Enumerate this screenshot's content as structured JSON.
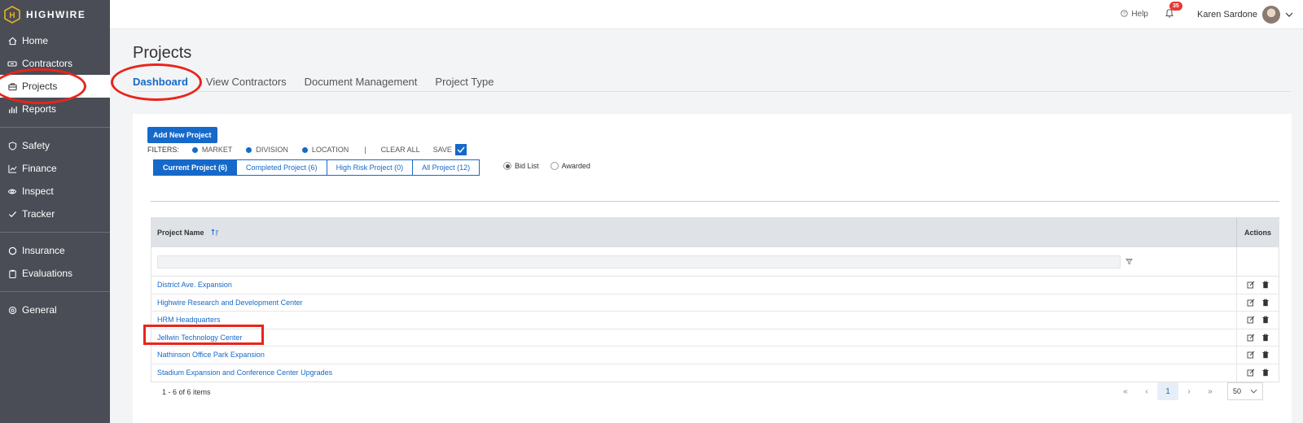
{
  "brand": {
    "name": "HIGHWIRE",
    "logo_letter": "H",
    "accent": "#e8b023"
  },
  "sidebar": {
    "items": [
      {
        "label": "Home",
        "icon": "home-icon"
      },
      {
        "label": "Contractors",
        "icon": "handshake-icon"
      },
      {
        "label": "Projects",
        "icon": "briefcase-icon",
        "active": true
      },
      {
        "label": "Reports",
        "icon": "bar-chart-icon"
      },
      {
        "label": "Safety",
        "icon": "shield-icon"
      },
      {
        "label": "Finance",
        "icon": "line-chart-icon"
      },
      {
        "label": "Inspect",
        "icon": "eye-icon"
      },
      {
        "label": "Tracker",
        "icon": "check-icon"
      },
      {
        "label": "Insurance",
        "icon": "circle-icon"
      },
      {
        "label": "Evaluations",
        "icon": "clipboard-icon"
      },
      {
        "label": "General",
        "icon": "gear-icon"
      }
    ]
  },
  "topbar": {
    "help": "Help",
    "notifications": "35",
    "user_name": "Karen Sardone"
  },
  "page": {
    "title": "Projects",
    "tabs": [
      "Dashboard",
      "View Contractors",
      "Document Management",
      "Project Type"
    ]
  },
  "toolbar": {
    "add_label": "Add New Project",
    "filters_label": "FILTERS:",
    "filters": [
      "MARKET",
      "DIVISION",
      "LOCATION"
    ],
    "divider": "|",
    "clear_all": "CLEAR ALL",
    "save": "SAVE"
  },
  "segments": [
    "Current Project (6)",
    "Completed Project (6)",
    "High Risk Project (0)",
    "All Project (12)"
  ],
  "radios": [
    "Bid List",
    "Awarded"
  ],
  "table": {
    "col_name": "Project Name",
    "col_actions": "Actions",
    "rows": [
      "District Ave. Expansion",
      "Highwire Research and Development Center",
      "HRM Headquarters",
      "Jellwin Technology Center",
      "Nathinson Office Park Expansion",
      "Stadium Expansion and Conference Center Upgrades"
    ]
  },
  "pagination": {
    "info": "1 - 6 of 6 items",
    "first": "«",
    "prev": "‹",
    "current": "1",
    "next": "›",
    "last": "»",
    "page_size": "50"
  },
  "colors": {
    "primary": "#1669c9",
    "sidebar": "#4a4d55",
    "highlight": "#e8251c"
  }
}
